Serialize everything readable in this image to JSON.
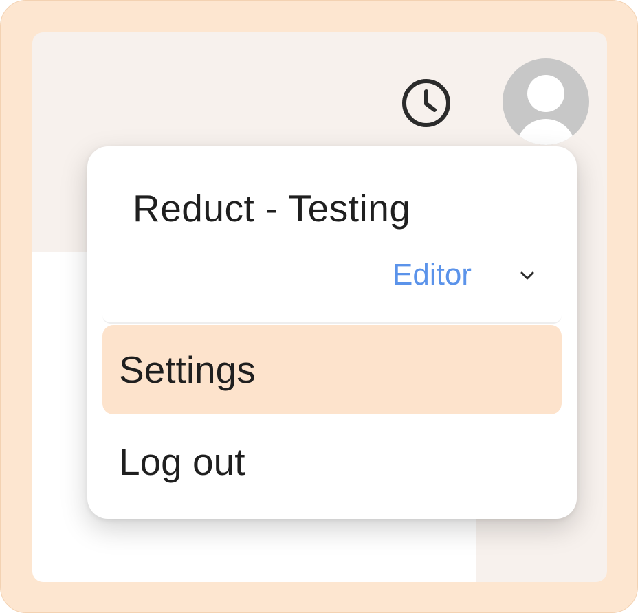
{
  "header": {
    "history_icon": "clock-icon",
    "avatar_icon": "user-avatar-icon"
  },
  "account_menu": {
    "workspace_name": "Reduct - Testing",
    "role": {
      "label": "Editor",
      "icon": "chevron-down-icon",
      "color": "#5b93ea"
    },
    "items": [
      {
        "label": "Settings",
        "highlighted": true
      },
      {
        "label": "Log out",
        "highlighted": false
      }
    ]
  },
  "colors": {
    "frame": "#fde6d0",
    "highlight": "#fde3cc",
    "background": "#f7f1ed"
  }
}
